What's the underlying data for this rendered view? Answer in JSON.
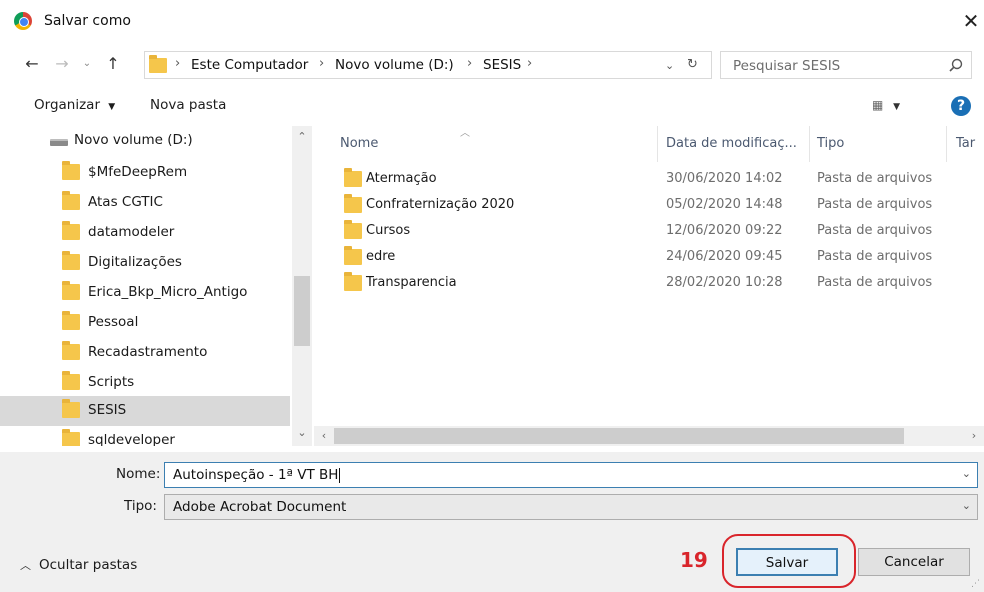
{
  "window": {
    "title": "Salvar como",
    "close_icon": "close-icon"
  },
  "nav": {
    "back_icon": "arrow-left-icon",
    "forward_icon": "arrow-right-icon",
    "recent_icon": "chevron-down-icon",
    "up_icon": "arrow-up-icon",
    "breadcrumb": [
      "Este Computador",
      "Novo volume (D:)",
      "SESIS"
    ],
    "refresh_icon": "refresh-icon",
    "search_placeholder": "Pesquisar SESIS"
  },
  "toolbar": {
    "organize_label": "Organizar",
    "new_folder_label": "Nova pasta"
  },
  "tree": {
    "drive_label": "Novo volume (D:)",
    "folders": [
      "$MfeDeepRem",
      "Atas CGTIC",
      "datamodeler",
      "Digitalizações",
      "Erica_Bkp_Micro_Antigo",
      "Pessoal",
      "Recadastramento",
      "Scripts",
      "SESIS",
      "sqldeveloper"
    ],
    "selected": "SESIS"
  },
  "list": {
    "columns": [
      "Nome",
      "Data de modificaç...",
      "Tipo",
      "Tar"
    ],
    "rows": [
      {
        "name": "Atermação",
        "date": "30/06/2020 14:02",
        "type": "Pasta de arquivos"
      },
      {
        "name": "Confraternização 2020",
        "date": "05/02/2020 14:48",
        "type": "Pasta de arquivos"
      },
      {
        "name": "Cursos",
        "date": "12/06/2020 09:22",
        "type": "Pasta de arquivos"
      },
      {
        "name": "edre",
        "date": "24/06/2020 09:45",
        "type": "Pasta de arquivos"
      },
      {
        "name": "Transparencia",
        "date": "28/02/2020 10:28",
        "type": "Pasta de arquivos"
      }
    ]
  },
  "form": {
    "name_label": "Nome:",
    "name_value": "Autoinspeção - 1ª VT BH",
    "type_label": "Tipo:",
    "type_value": "Adobe Acrobat Document",
    "hide_folders_label": "Ocultar pastas",
    "save_label": "Salvar",
    "cancel_label": "Cancelar",
    "annotation_number": "19"
  },
  "colors": {
    "accent": "#3c7fb1",
    "annotation": "#d9252b",
    "folder": "#f5c64b",
    "help": "#1a6fb5"
  }
}
